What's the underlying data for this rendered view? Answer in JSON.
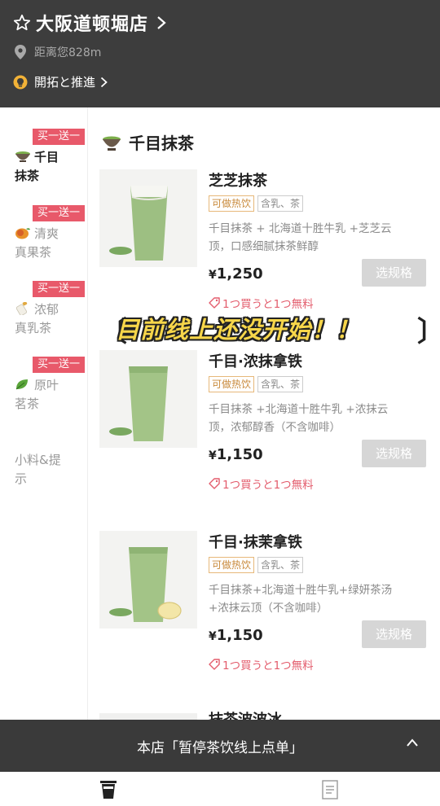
{
  "header": {
    "store_name": "大阪道顿堀店",
    "distance": "距离您828m",
    "promo": "開拓と推進"
  },
  "sidebar": {
    "items": [
      {
        "badge": "买一送一",
        "label_line1": "千目",
        "label_line2": "抹茶",
        "active": true
      },
      {
        "badge": "买一送一",
        "label_line1": "清爽",
        "label_line2": "真果茶",
        "active": false
      },
      {
        "badge": "买一送一",
        "label_line1": "浓郁",
        "label_line2": "真乳茶",
        "active": false
      },
      {
        "badge": "买一送一",
        "label_line1": "原叶",
        "label_line2": "茗茶",
        "active": false
      },
      {
        "label_line1": "小料&提",
        "label_line2": "示",
        "active": false
      }
    ]
  },
  "section": {
    "title": "千目抹茶"
  },
  "products": [
    {
      "name": "芝芝抹茶",
      "tags": [
        "可做热饮",
        "含乳、茶"
      ],
      "desc_line1": "千目抹茶 + 北海道十胜牛乳 +芝芝云",
      "desc_line2": "顶，口感细腻抹茶鲜醇",
      "currency": "¥",
      "price": "1,250",
      "button": "选规格",
      "coupon": "1つ買うと1つ無料"
    },
    {
      "name": "千目·浓抹拿铁",
      "tags": [
        "可做热饮",
        "含乳、茶"
      ],
      "desc_line1": "千目抹茶 +北海道十胜牛乳 +浓抹云",
      "desc_line2": "顶，浓郁醇香（不含咖啡）",
      "currency": "¥",
      "price": "1,150",
      "button": "选规格",
      "coupon": "1つ買うと1つ無料"
    },
    {
      "name": "千目·抹茉拿铁",
      "tags": [
        "可做热饮",
        "含乳、茶"
      ],
      "desc_line1": "千目抹茶+北海道十胜牛乳+绿妍茶汤",
      "desc_line2": "+浓抹云顶（不含咖啡）",
      "currency": "¥",
      "price": "1,150",
      "button": "选规格",
      "coupon": "1つ買うと1つ無料"
    }
  ],
  "peek_product": {
    "name": "抹茶波波冰"
  },
  "overlay": {
    "text": "目前线上还没开始！！",
    "left_bracket": "〔",
    "right_bracket": "〕"
  },
  "notice": {
    "text": "本店「暂停茶饮线上点单」"
  },
  "tabbar": {
    "tabs": [
      {
        "icon": "cup-icon",
        "active": true
      },
      {
        "icon": "order-list-icon",
        "active": false
      }
    ]
  },
  "colors": {
    "header_bg": "#3d3d3d",
    "badge_bg": "#e8596a",
    "coupon": "#e35c6c",
    "hot_tag": "#c8893a",
    "button_disabled": "#d6d6d6",
    "overlay_text": "#f7d64a"
  }
}
